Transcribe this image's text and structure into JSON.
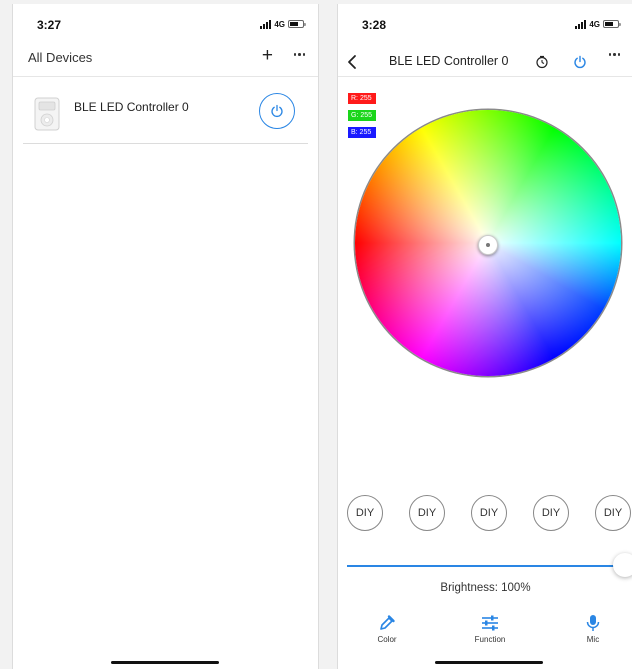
{
  "left_screen": {
    "status": {
      "time": "3:27",
      "network": "4G"
    },
    "nav": {
      "title": "All Devices",
      "add_icon": "plus-icon",
      "more_icon": "more-icon"
    },
    "devices": [
      {
        "name": "BLE LED Controller 0",
        "icon": "device-icon",
        "action_icon": "power-icon"
      }
    ]
  },
  "right_screen": {
    "status": {
      "time": "3:28",
      "network": "4G"
    },
    "nav": {
      "title": "BLE LED Controller 0",
      "back_icon": "chevron-left-icon",
      "timer_icon": "timer-icon",
      "power_icon": "power-icon",
      "more_icon": "more-icon"
    },
    "rgb": {
      "r": "R: 255",
      "g": "G: 255",
      "b": "B: 255"
    },
    "diy_buttons": [
      "DIY",
      "DIY",
      "DIY",
      "DIY",
      "DIY"
    ],
    "brightness": {
      "label": "Brightness: 100%",
      "value": 1.0
    },
    "tabs": [
      {
        "label": "Color",
        "icon": "eyedropper-icon"
      },
      {
        "label": "Function",
        "icon": "sliders-icon"
      },
      {
        "label": "Mic",
        "icon": "microphone-icon"
      }
    ]
  },
  "colors": {
    "accent": "#2a86e4",
    "red_tag": "#ff1a1a",
    "green_tag": "#1ad61a",
    "blue_tag": "#1a1aff"
  }
}
